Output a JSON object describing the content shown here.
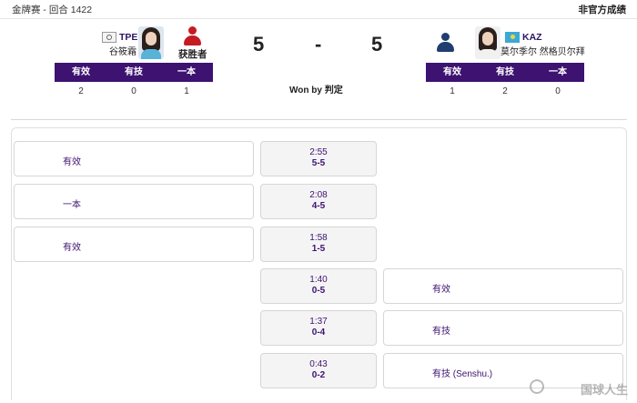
{
  "topbar": {
    "event": "金牌赛  - 回合 1422",
    "status": "非官方成绩"
  },
  "athlete_left": {
    "code": "TPE",
    "name": "谷筱霜",
    "winner_label": "获胜者"
  },
  "athlete_right": {
    "code": "KAZ",
    "name": "莫尔季尔 然格贝尔拜"
  },
  "score": {
    "left": "5",
    "dash": "-",
    "right": "5"
  },
  "result": {
    "won_by": "Won by  判定"
  },
  "table_headers": [
    "有效",
    "有技",
    "一本"
  ],
  "left_counts": [
    "2",
    "0",
    "1"
  ],
  "right_counts": [
    "1",
    "2",
    "0"
  ],
  "events": [
    {
      "side": "left",
      "label": "有效",
      "time": "2:55",
      "score": "5-5"
    },
    {
      "side": "left",
      "label": "一本",
      "time": "2:08",
      "score": "4-5"
    },
    {
      "side": "left",
      "label": "有效",
      "time": "1:58",
      "score": "1-5"
    },
    {
      "side": "right",
      "label": "有效",
      "time": "1:40",
      "score": "0-5"
    },
    {
      "side": "right",
      "label": "有技",
      "time": "1:37",
      "score": "0-4"
    },
    {
      "side": "right",
      "label": "有技  (Senshu.)",
      "time": "0:43",
      "score": "0-2"
    }
  ],
  "watermark": "国球人生",
  "colors": {
    "header_purple": "#3d1270",
    "winner_red": "#c51c23",
    "icon_blue": "#1f3d6e"
  }
}
